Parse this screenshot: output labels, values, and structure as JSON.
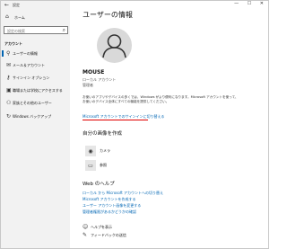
{
  "window": {
    "title": "設定",
    "controls": "— ☐ ✕"
  },
  "sidebar": {
    "home_label": "ホーム",
    "search_placeholder": "設定の検索",
    "section_title": "アカウント",
    "items": [
      {
        "label": "ユーザーの情報",
        "icon": "user-icon",
        "selected": true
      },
      {
        "label": "メール＆アカウント",
        "icon": "mail-icon",
        "selected": false
      },
      {
        "label": "サインイン オプション",
        "icon": "key-icon",
        "selected": false
      },
      {
        "label": "職場または学校にアクセスする",
        "icon": "briefcase-icon",
        "selected": false
      },
      {
        "label": "家族とその他のユーザー",
        "icon": "people-icon",
        "selected": false
      },
      {
        "label": "Windows バックアップ",
        "icon": "sync-icon",
        "selected": false
      }
    ]
  },
  "main": {
    "title": "ユーザーの情報",
    "user_name": "MOUSE",
    "account_type": "ローカル アカウント",
    "account_role": "管理者",
    "description": "お使いのアプリやデバイスの多くでは、Windows がより便利になります。Microsoft アカウントを使って、お使いのデバイス全体にすべての機能を提供してください。",
    "signin_link": "Microsoft アカウントでのサインインに切り替える",
    "picture_heading": "自分の画像を作成",
    "picture_options": [
      {
        "label": "カメラ",
        "icon": "camera-icon"
      },
      {
        "label": "参照",
        "icon": "folder-icon"
      }
    ],
    "help_heading": "Web のヘルプ",
    "help_links": [
      "ローカル から Microsoft アカウントへの切り替え",
      "Microsoft アカウントを作成する",
      "ユーザー アカウント画像を変更する",
      "管理者権限があるかどうかの確認"
    ],
    "footer": [
      {
        "label": "ヘルプを表示",
        "icon": "help-icon"
      },
      {
        "label": "フィードバックの送信",
        "icon": "feedback-icon"
      }
    ]
  },
  "colors": {
    "accent": "#0063b1",
    "link": "#0066b4",
    "highlight": "#e00000",
    "sidebar_bg": "#f2f2f2"
  }
}
